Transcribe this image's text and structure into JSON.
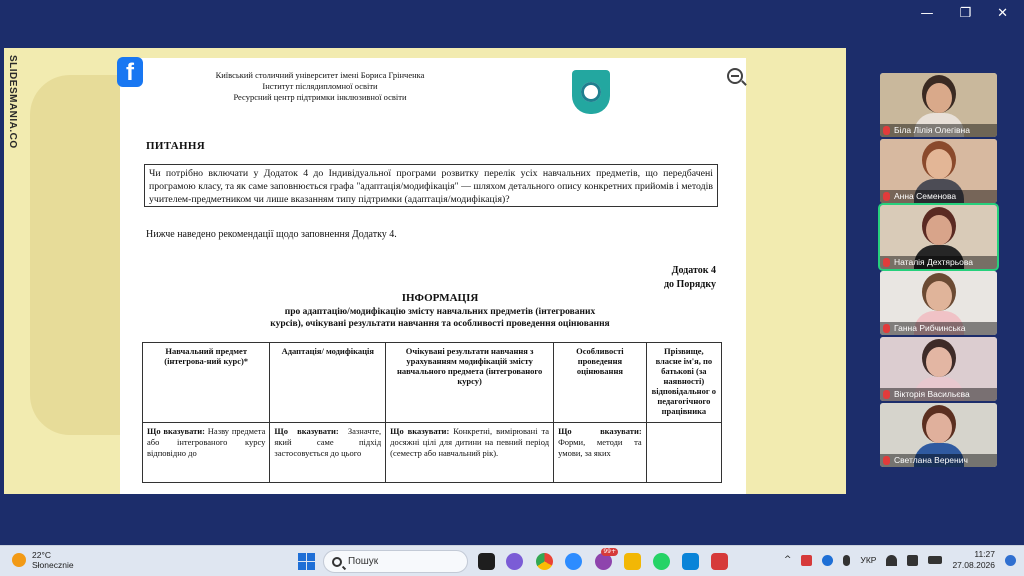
{
  "window_controls": {
    "minimize": "—",
    "restore": "❐",
    "close": "✕"
  },
  "slide": {
    "brand": "SLIDESMANIA.CO",
    "document": {
      "header_lines": [
        "Київський столичний університет імені Бориса Грінченка",
        "Інститут післядипломної освіти",
        "Ресурсний центр підтримки інклюзивної освіти"
      ],
      "question_title": "ПИТАННЯ",
      "question_text": "Чи потрібно включати у Додаток 4 до Індивідуальної програми розвитку перелік усіх навчальних предметів, що передбачені програмою класу, та як саме заповнюється графа \"адаптація/модифікація\" — шляхом детального опису конкретних прийомів і методів учителем-предметником чи лише вказанням типу підтримки (адаптація/модифікація)?",
      "recommendation": "Нижче наведено рекомендації щодо заповнення Додатку 4.",
      "annex_line1": "Додаток 4",
      "annex_line2": "до Порядку",
      "info_title": "ІНФОРМАЦІЯ",
      "info_subtitle": "про адаптацію/модифікацію змісту навчальних предметів (інтегрованих курсів), очікувані результати навчання та особливості проведення оцінювання",
      "table": {
        "headers": [
          "Навчальний предмет (інтегрова-ний курс)*",
          "Адаптація/ модифікація",
          "Очікувані результати навчання з урахуванням модифікацій змісту навчального предмета (інтегрованого курсу)",
          "Особливості проведення оцінювання",
          "Прізвище, власне ім'я, по батькові (за наявності) відповідальног о педагогічного працівника"
        ],
        "row": [
          {
            "lead": "Що вказувати:",
            "text": "Назву предмета або інтегрованого курсу відповідно до"
          },
          {
            "lead": "Що вказувати:",
            "text": "Зазначте, який саме підхід застосовується до цього"
          },
          {
            "lead": "Що вказувати:",
            "text": "Конкретні, вимірювані та досяжні цілі для дитини на певний період (семестр або навчальний рік)."
          },
          {
            "lead": "Що вказувати:",
            "text": "Форми, методи та умови, за яких"
          },
          {
            "lead": "",
            "text": ""
          }
        ]
      }
    }
  },
  "participants": [
    {
      "name": "Біла Лілія Олегівна",
      "bg": "#c9b89c",
      "skin": "#d9a98a",
      "hair": "#3a2a22",
      "shirt": "#e8e0d8"
    },
    {
      "name": "Анна Семенова",
      "bg": "#d7b9a0",
      "skin": "#e3b696",
      "hair": "#8a4a2c",
      "shirt": "#4c4c55"
    },
    {
      "name": "Наталія Дехтярьова",
      "bg": "#d9cbb8",
      "skin": "#d8a48a",
      "hair": "#5a2a22",
      "shirt": "#262626",
      "active": true
    },
    {
      "name": "Ганна Рибчинська",
      "bg": "#e9e6e2",
      "skin": "#e0b49a",
      "hair": "#6b4a33",
      "shirt": "#f0c2c6"
    },
    {
      "name": "Вікторія Васильєва",
      "bg": "#dccdd0",
      "skin": "#e3b6a3",
      "hair": "#3e2b28",
      "shirt": "#e8c8cf"
    },
    {
      "name": "Светлана Веренич",
      "bg": "#d6d4cc",
      "skin": "#e0b09c",
      "hair": "#5b2f20",
      "shirt": "#2f5aa0"
    }
  ],
  "taskbar": {
    "temperature": "22°C",
    "weather": "Słonecznie",
    "search_placeholder": "Пошук",
    "badge_count": "99+",
    "language": "УКР",
    "time": "11:27",
    "date": "27.08.2026",
    "tray_chevron": "^"
  }
}
